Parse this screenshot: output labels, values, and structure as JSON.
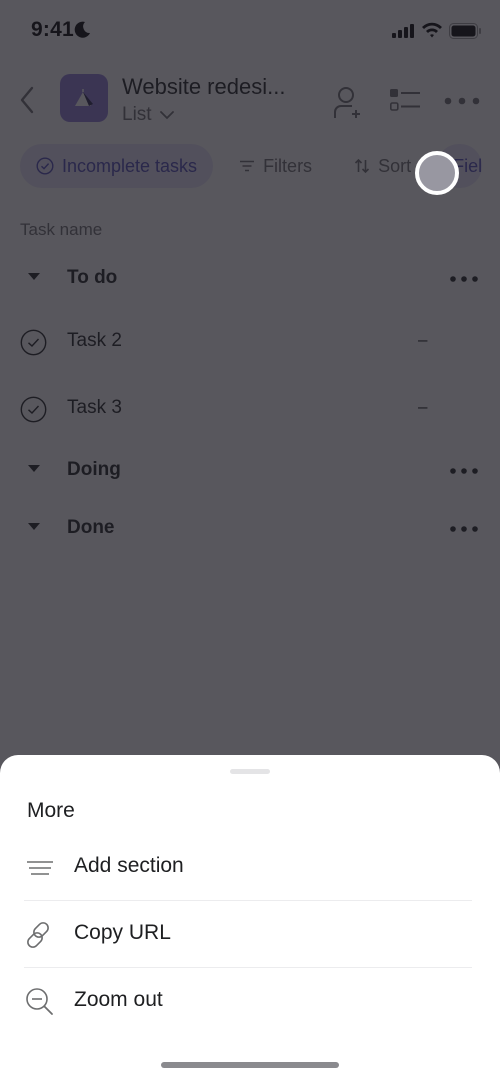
{
  "status_bar": {
    "time": "9:41",
    "focus_icon": "moon-icon",
    "signal_icon": "cellular-signal-icon",
    "wifi_icon": "wifi-icon",
    "battery_icon": "battery-icon"
  },
  "header": {
    "back_icon": "chevron-left-icon",
    "project_icon": "project-tent-icon",
    "project_color": "#8e7dd8",
    "project_title": "Website redesi...",
    "view_label": "List",
    "view_icon": "chevron-down-icon",
    "actions": [
      {
        "name": "add-member",
        "icon": "person-add-icon"
      },
      {
        "name": "toggle-view",
        "icon": "checklist-icon"
      },
      {
        "name": "more",
        "icon": "more-horizontal-icon"
      }
    ]
  },
  "filters": {
    "chips": [
      {
        "label": "Incomplete tasks",
        "icon": "check-circle-icon",
        "active": true
      },
      {
        "label": "Filters",
        "icon": "filter-icon",
        "active": false
      },
      {
        "label": "Sort",
        "icon": "sort-icon",
        "active": false
      },
      {
        "label": "Fiel",
        "icon": "fields-icon",
        "active": true
      }
    ]
  },
  "list": {
    "column_header": "Task name",
    "sections": [
      {
        "name": "To do",
        "tasks": [
          {
            "name": "Task 2",
            "due": "–"
          },
          {
            "name": "Task 3",
            "due": "–"
          }
        ]
      },
      {
        "name": "Doing",
        "tasks": []
      },
      {
        "name": "Done",
        "tasks": []
      }
    ]
  },
  "sheet": {
    "title": "More",
    "items": [
      {
        "label": "Add section",
        "icon": "add-section-icon"
      },
      {
        "label": "Copy URL",
        "icon": "link-icon"
      },
      {
        "label": "Zoom out",
        "icon": "zoom-out-icon"
      }
    ]
  },
  "colors": {
    "accent": "#4f4ab8",
    "accent_bg": "#e6e2f9",
    "scrim": "#58565c",
    "sheet_bg": "#ffffff"
  }
}
